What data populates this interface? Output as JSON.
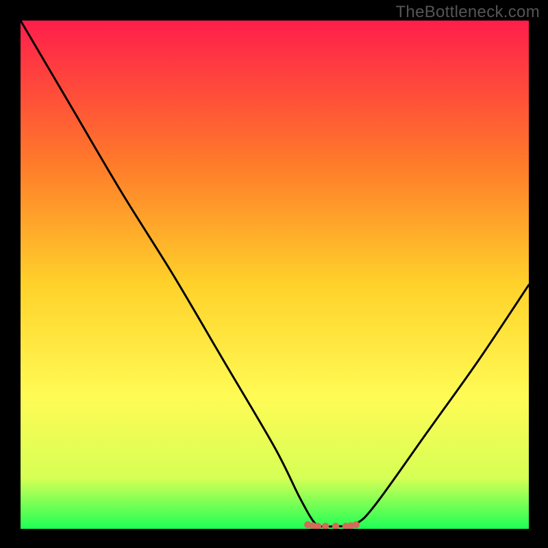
{
  "watermark": "TheBottleneck.com",
  "colors": {
    "background": "#000000",
    "gradient_top": "#ff1e4b",
    "gradient_mid1": "#ff7a2a",
    "gradient_mid2": "#ffd22a",
    "gradient_mid3": "#fffb55",
    "gradient_mid4": "#d6ff55",
    "gradient_bot": "#1eff55",
    "curve": "#000000",
    "marker": "#d36a5a"
  },
  "chart_data": {
    "type": "line",
    "title": "",
    "xlabel": "",
    "ylabel": "",
    "xlim": [
      0,
      100
    ],
    "ylim": [
      0,
      100
    ],
    "series": [
      {
        "name": "bottleneck-curve",
        "x": [
          0,
          10,
          20,
          30,
          40,
          50,
          55,
          58,
          60,
          62,
          66,
          70,
          80,
          90,
          100
        ],
        "y": [
          100,
          83,
          66,
          50,
          33,
          16,
          6,
          1,
          0.5,
          0.5,
          1,
          5,
          19,
          33,
          48
        ]
      },
      {
        "name": "optimum-markers",
        "x": [
          56.5,
          57.5,
          58.5,
          60,
          62,
          64,
          65,
          66
        ],
        "y": [
          0.8,
          0.6,
          0.5,
          0.5,
          0.5,
          0.5,
          0.6,
          0.8
        ]
      }
    ],
    "optimum_range_x": [
      56,
      66
    ]
  }
}
